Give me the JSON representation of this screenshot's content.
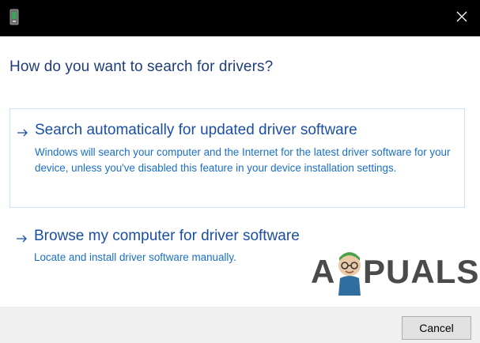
{
  "window": {
    "icon": "device-icon",
    "close_icon": "close-icon"
  },
  "heading": "How do you want to search for drivers?",
  "options": [
    {
      "icon": "arrow-right-icon",
      "title": "Search automatically for updated driver software",
      "description": "Windows will search your computer and the Internet for the latest driver software for your device, unless you've disabled this feature in your device installation settings."
    },
    {
      "icon": "arrow-right-icon",
      "title": "Browse my computer for driver software",
      "description": "Locate and install driver software manually."
    }
  ],
  "footer": {
    "cancel_label": "Cancel"
  },
  "watermark": {
    "lead": "A",
    "rest": "PUALS"
  },
  "colors": {
    "titlebar": "#000000",
    "heading": "#1f3d7a",
    "link_title": "#1a4fa3",
    "link_desc": "#1a6fc4",
    "highlight_border": "#cfe3f5",
    "footer": "#f0f0f0"
  }
}
